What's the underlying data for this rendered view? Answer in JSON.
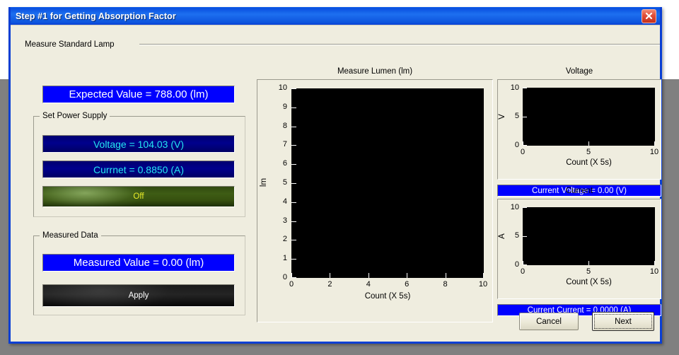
{
  "window": {
    "title": "Step #1 for Getting Absorption Factor",
    "close_icon": "close-icon",
    "titlebar_color": "#0a51e0",
    "client_bg": "#efeddf"
  },
  "section": {
    "title": "Measure Standard Lamp"
  },
  "expected": {
    "text": "Expected Value = 788.00 (lm)",
    "bg": "#0000ff",
    "fg": "#ffffff"
  },
  "power_supply": {
    "title": "Set Power Supply",
    "voltage_text": "Voltage = 104.03 (V)",
    "current_text": "Currnet = 0.8850 (A)",
    "toggle_label": "Off",
    "readout_bg": "#000080",
    "readout_fg": "#24e8f0",
    "toggle_bg": "#3e5c14",
    "toggle_fg": "#e8ea28"
  },
  "measured_data": {
    "title": "Measured Data",
    "value_text": "Measured Value = 0.00 (lm)",
    "apply_label": "Apply",
    "value_bg": "#0000ff",
    "value_fg": "#ffffff",
    "apply_bg": "#141414",
    "apply_fg": "#ffffff"
  },
  "footer": {
    "cancel_label": "Cancel",
    "next_label": "Next"
  },
  "chart_data": [
    {
      "id": "measure-lumen",
      "type": "line",
      "title": "Measure Lumen (lm)",
      "xlabel": "Count (X 5s)",
      "ylabel": "lm",
      "xlim": [
        0,
        10
      ],
      "ylim": [
        0,
        10
      ],
      "xticks": [
        "0",
        "2",
        "4",
        "6",
        "8",
        "10"
      ],
      "yticks": [
        "0",
        "1",
        "2",
        "3",
        "4",
        "5",
        "6",
        "7",
        "8",
        "9",
        "10"
      ],
      "series": [
        {
          "name": "Measure Lumen",
          "x": [],
          "values": []
        }
      ],
      "grid": false,
      "legend": "none",
      "plot_bg": "#000000"
    },
    {
      "id": "voltage",
      "type": "line",
      "title": "Voltage",
      "xlabel": "Count (X 5s)",
      "ylabel": "V",
      "xlim": [
        0,
        10
      ],
      "ylim": [
        0,
        10
      ],
      "xticks": [
        "0",
        "5",
        "10"
      ],
      "yticks": [
        "0",
        "5",
        "10"
      ],
      "series": [
        {
          "name": "Voltage",
          "x": [],
          "values": []
        }
      ],
      "grid": false,
      "legend": "none",
      "plot_bg": "#000000"
    },
    {
      "id": "current",
      "type": "line",
      "title": "Current",
      "xlabel": "Count (X 5s)",
      "ylabel": "A",
      "xlim": [
        0,
        10
      ],
      "ylim": [
        0,
        10
      ],
      "xticks": [
        "0",
        "5",
        "10"
      ],
      "yticks": [
        "0",
        "5",
        "10"
      ],
      "series": [
        {
          "name": "Current",
          "x": [],
          "values": []
        }
      ],
      "grid": false,
      "legend": "none",
      "plot_bg": "#000000"
    }
  ],
  "readouts": {
    "current_voltage": "Current Voltage = 0.00 (V)",
    "current_current": "Current Current = 0.0000 (A)",
    "bg": "#0000ff",
    "fg": "#ffffff"
  }
}
